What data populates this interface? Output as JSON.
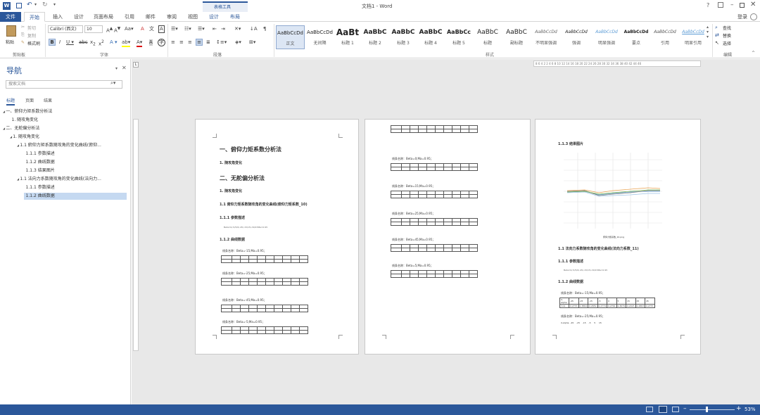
{
  "window": {
    "title": "文档1 - Word",
    "context_tab": "表格工具",
    "help": "?",
    "user": "登录"
  },
  "tabs": [
    "文件",
    "开始",
    "插入",
    "设计",
    "页面布局",
    "引用",
    "邮件",
    "审阅",
    "视图",
    "设计",
    "布局"
  ],
  "ribbon": {
    "clipboard": {
      "paste": "粘贴",
      "cut": "剪切",
      "copy": "复制",
      "format_painter": "格式刷",
      "label": "剪贴板"
    },
    "font": {
      "name": "Calibri (西文)",
      "size": "10",
      "label": "字体"
    },
    "paragraph": {
      "label": "段落"
    },
    "styles": {
      "label": "样式",
      "items": [
        {
          "preview": "AaBbCcDd",
          "name": "正文"
        },
        {
          "preview": "AaBbCcDd",
          "name": "无间隔"
        },
        {
          "preview": "AaBt",
          "name": "标题 1"
        },
        {
          "preview": "AaBbC",
          "name": "标题 2"
        },
        {
          "preview": "AaBbC",
          "name": "标题 3"
        },
        {
          "preview": "AaBbC",
          "name": "标题 4"
        },
        {
          "preview": "AaBbCc",
          "name": "标题 5"
        },
        {
          "preview": "AaBbC",
          "name": "标题"
        },
        {
          "preview": "AaBbC",
          "name": "副标题"
        },
        {
          "preview": "AaBbCcDd",
          "name": "不明显强调"
        },
        {
          "preview": "AaBbCcDd",
          "name": "强调"
        },
        {
          "preview": "AaBbCcDd",
          "name": "明显强调"
        },
        {
          "preview": "AaBbCcDd",
          "name": "要点"
        },
        {
          "preview": "AaBbCcDd",
          "name": "引用"
        },
        {
          "preview": "AaBbCcDd",
          "name": "明显引用"
        }
      ]
    },
    "editing": {
      "find": "查找",
      "replace": "替换",
      "select": "选择",
      "label": "编辑"
    }
  },
  "nav": {
    "title": "导航",
    "search_placeholder": "搜索文档",
    "tabs": [
      "标题",
      "页面",
      "结果"
    ],
    "tree": [
      {
        "t": "一、俯仰力矩系数分析法",
        "lvl": 0
      },
      {
        "t": "1. 随攻角变化",
        "lvl": 1
      },
      {
        "t": "二、无舵偏分析法",
        "lvl": 0
      },
      {
        "t": "1. 随攻角变化",
        "lvl": 1
      },
      {
        "t": "1.1 俯仰力矩系数随攻角的变化曲线(俯仰...",
        "lvl": 2
      },
      {
        "t": "1.1.1 参数描述",
        "lvl": 3
      },
      {
        "t": "1.1.2 曲线数据",
        "lvl": 3
      },
      {
        "t": "1.1.3 结果图片",
        "lvl": 3
      },
      {
        "t": "1.1 法向力系数随攻角的变化曲线(法向力...",
        "lvl": 2
      },
      {
        "t": "1.1.1 参数描述",
        "lvl": 3
      },
      {
        "t": "1.1.2 曲线数据",
        "lvl": 3,
        "sel": true
      }
    ]
  },
  "ruler": "8 6 4 2 2 4 6 8 10 12 14 16 18 20 22 24 26 28 30 32 34 36 38 40 42 44 46",
  "page1": {
    "h1a": "一、俯仰力矩系数分析法",
    "s1": "1.  随攻角变化",
    "h1b": "二、无舵偏分析法",
    "s2": "1.  随攻角变化",
    "s3": "1.1  俯仰力矩系数随攻角的变化曲线(俯仰力矩系数_10)",
    "s4": "1.1.1  参数描述",
    "param": "Beta=0/-5/5/0/-45/-15/15/-30/15Ma=0.95",
    "s5": "1.1.2  曲线数据",
    "c1": "线条名称：Beta=-15;Ma=0.95；",
    "c2": "线条名称：Beta=-25;Ma=0.95；",
    "c3": "线条名称：Beta=-45;Ma=0.95；",
    "c4": "线条名称：Beta=-5;Ma=0.95；"
  },
  "page2": {
    "c1": "线条名称：Beta=0;Ma=0.95；",
    "c2": "线条名称：Beta=15;Ma=0.95；",
    "c3": "线条名称：Beta=25;Ma=0.95；",
    "c4": "线条名称：Beta=45;Ma=0.95；",
    "c5": "线条名称：Beta=5;Ma=0.95；"
  },
  "page3": {
    "s1": "1.1.3  结果图片",
    "caption": "俯仰力矩系数_10.png",
    "s2": "1.1  法向力系数随攻角的变化曲线(法向力系数_11)",
    "s3": "1.1.1  参数描述",
    "param": "Beta=0/-5/5/0/-45/-15/15/-30/15Ma=0.95",
    "s4": "1.1.2  曲线数据",
    "c1": "线条名称：Beta=-15;Ma=0.95；",
    "c2": "线条名称：Beta=-25;Ma=0.95；",
    "alpha_row": "X-Alpha  -45    -25    -15    -5     5     15",
    "row1": [
      "X-Alpha",
      "-45",
      "-25",
      "-15",
      "-5",
      "0",
      "5",
      "15",
      "25",
      "45"
    ],
    "row2": [
      "Y-Ck",
      "0.2733",
      "0.3864",
      "0.2659",
      "0.2774",
      "0.2764",
      "0.3679",
      "0.2415",
      "0.2863",
      "0.2737"
    ]
  },
  "statusbar": {
    "zoom": "53%"
  },
  "colors": {
    "accent": "#2b579a",
    "ribbon_word": "#2b579a"
  }
}
